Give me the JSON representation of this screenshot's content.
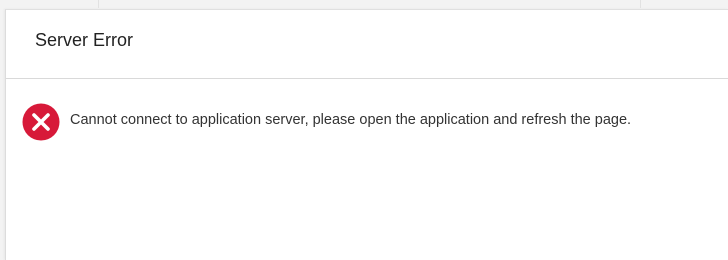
{
  "dialog": {
    "title": "Server Error",
    "message": "Cannot connect to application server, please open the application and refresh the page.",
    "icon": "error-circle-x-icon",
    "icon_color": "#d71939"
  }
}
